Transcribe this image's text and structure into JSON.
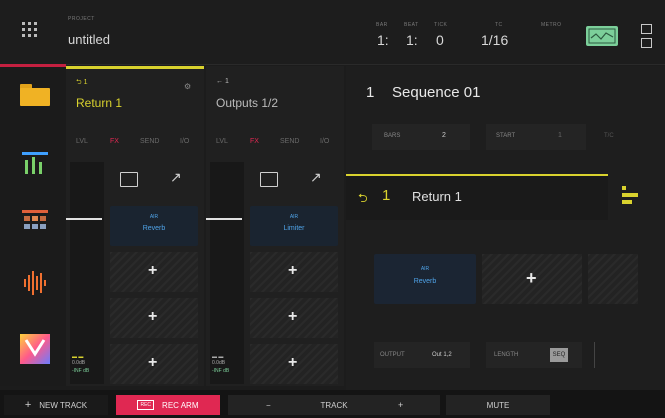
{
  "topbar": {
    "project_label": "PROJECT",
    "project_name": "untitled",
    "bar_label": "BAR",
    "beat_label": "BEAT",
    "tick_label": "TICK",
    "bar": "1:",
    "beat": "1:",
    "tick": "0",
    "tc_label": "TC",
    "tc_value": "1/16",
    "metro_label": "METRO"
  },
  "rail": {
    "items": [
      "folder-icon",
      "mixer-icon",
      "grid-icon",
      "waveform-icon",
      "plugin-icon"
    ]
  },
  "track1": {
    "number": "1",
    "name": "Return 1",
    "tabs": [
      "LVL",
      "FX",
      "SEND",
      "I/O"
    ],
    "slot_brand": "AIR",
    "slot_name": "Reverb",
    "meter_label_1": "0.0dB",
    "meter_label_2": "-INF dB"
  },
  "track2": {
    "number": "1",
    "name": "Outputs 1/2",
    "tabs": [
      "LVL",
      "FX",
      "SEND",
      "I/O"
    ],
    "slot_brand": "AIR",
    "slot_name": "Limiter",
    "meter_label_1": "0.0dB",
    "meter_label_2": "-INF dB"
  },
  "sequence": {
    "number": "1",
    "name": "Sequence 01",
    "bars_label": "BARS",
    "bars_value": "2",
    "start_label": "START",
    "start_value": "1",
    "tc_label": "T/C"
  },
  "selected_track": {
    "number": "1",
    "name": "Return 1",
    "slot_brand": "AIR",
    "slot_name": "Reverb",
    "output_label": "OUTPUT",
    "output_value": "Out 1,2",
    "length_label": "LENGTH",
    "length_value": "SEQ"
  },
  "bottom": {
    "new_track": "NEW TRACK",
    "rec_arm": "REC ARM",
    "rec_badge": "REC",
    "track": "TRACK",
    "mute": "MUTE"
  },
  "colors": {
    "accent_yellow": "#d9d22e",
    "accent_red": "#e02852",
    "accent_green": "#7ccf9a",
    "slot_blue": "#4fa3e8"
  }
}
